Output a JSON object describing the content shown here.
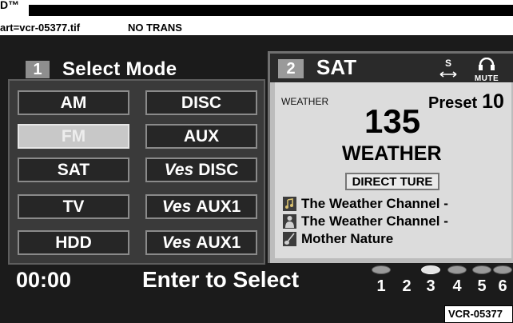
{
  "print_header": {
    "tm": "D™",
    "art": "art=vcr-05377.tif",
    "trans": "NO TRANS"
  },
  "mode_panel": {
    "number": "1",
    "title": "Select Mode",
    "selected": "FM",
    "buttons": [
      {
        "id": "am",
        "label": "AM"
      },
      {
        "id": "disc",
        "label": "DISC"
      },
      {
        "id": "fm",
        "label": "FM"
      },
      {
        "id": "aux",
        "label": "AUX"
      },
      {
        "id": "sat",
        "label": "SAT"
      },
      {
        "id": "ves-disc",
        "prefix": "Ves",
        "label": "DISC"
      },
      {
        "id": "tv",
        "label": "TV"
      },
      {
        "id": "ves-aux1-a",
        "prefix": "Ves",
        "label": "AUX1"
      },
      {
        "id": "hdd",
        "label": "HDD"
      },
      {
        "id": "ves-aux1-b",
        "prefix": "Ves",
        "label": "AUX1"
      }
    ]
  },
  "sat_panel": {
    "number": "2",
    "title": "SAT",
    "scan_icon_label": "S",
    "mute_label": "MUTE",
    "category_small": "WEATHER",
    "preset_label": "Preset",
    "preset_number": "10",
    "channel": "135",
    "channel_name": "WEATHER",
    "direct_button": "DIRECT TURE",
    "info": [
      {
        "icon": "music-note-icon",
        "text": "The Weather Channel -"
      },
      {
        "icon": "person-icon",
        "text": "The Weather Channel -"
      },
      {
        "icon": "guitar-icon",
        "text": "Mother Nature"
      }
    ]
  },
  "bottom_bar": {
    "time": "00:00",
    "hint": "Enter to Select",
    "presets": [
      {
        "n": "1",
        "dot": "inactive"
      },
      {
        "n": "2",
        "dot": "none"
      },
      {
        "n": "3",
        "dot": "active"
      },
      {
        "n": "4",
        "dot": "inactive"
      },
      {
        "n": "5",
        "dot": "inactive"
      },
      {
        "n": "6",
        "dot": "inactive"
      }
    ]
  },
  "figure_id": "VCR-05377",
  "colors": {
    "screen_bg": "#1b1b1b",
    "panel_bg": "#3a3a3a",
    "selected_button": "#c8c8c8",
    "sat_panel_bg": "#dcdcdc"
  }
}
